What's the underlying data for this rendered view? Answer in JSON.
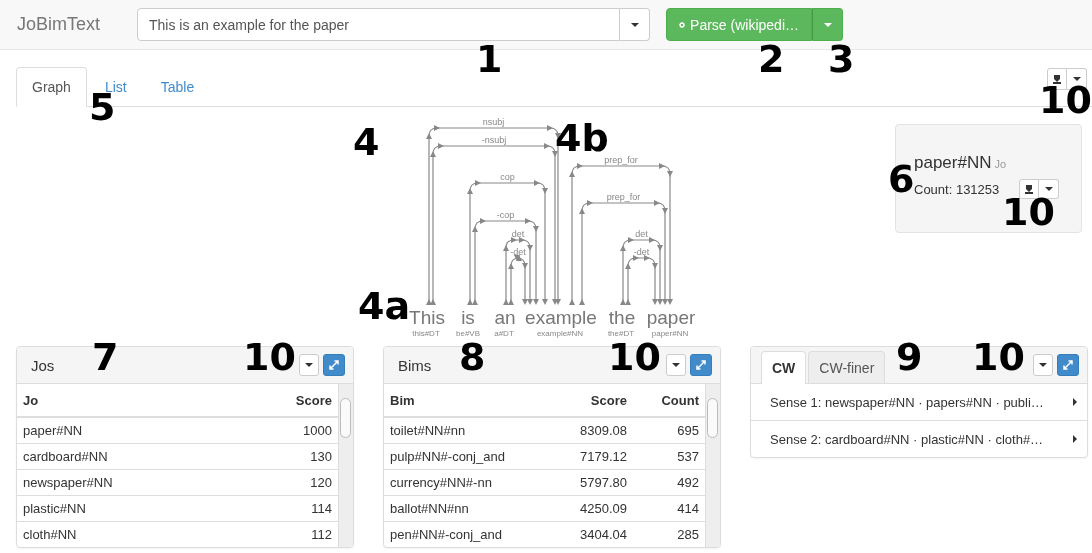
{
  "app": {
    "brand": "JoBimText"
  },
  "query": {
    "value": "This is an example for the paper"
  },
  "parse_button": {
    "label": "Parse (wikipedi…"
  },
  "tabs": [
    {
      "label": "Graph",
      "selected": true
    },
    {
      "label": "List",
      "selected": false
    },
    {
      "label": "Table",
      "selected": false
    }
  ],
  "graph": {
    "words": [
      {
        "word": "This",
        "tag": "this#DT"
      },
      {
        "word": "is",
        "tag": "be#VB"
      },
      {
        "word": "an",
        "tag": "a#DT"
      },
      {
        "word": "example",
        "tag": "example#NN"
      },
      {
        "word": "the",
        "tag": "the#DT"
      },
      {
        "word": "paper",
        "tag": "paper#NN"
      }
    ],
    "arcs": [
      {
        "label": "nsubj",
        "children": [
          {
            "label": "-nsubj",
            "children": [
              {
                "label": "cop",
                "children": [
                  {
                    "label": "-cop",
                    "children": [
                      {
                        "label": "det",
                        "children": [
                          {
                            "label": "-det"
                          }
                        ]
                      }
                    ]
                  }
                ]
              }
            ]
          }
        ]
      },
      {
        "label": "prep_for",
        "children": [
          {
            "label": "prep_for",
            "children": [
              {
                "label": "det",
                "children": [
                  {
                    "label": "-det"
                  }
                ]
              }
            ]
          }
        ]
      }
    ]
  },
  "term_card": {
    "term": "paper#NN",
    "type": "Jo",
    "count": "Count: 131253"
  },
  "jos_panel": {
    "title": "Jos",
    "columns": [
      "Jo",
      "Score"
    ],
    "rows": [
      [
        "paper#NN",
        "1000"
      ],
      [
        "cardboard#NN",
        "130"
      ],
      [
        "newspaper#NN",
        "120"
      ],
      [
        "plastic#NN",
        "114"
      ],
      [
        "cloth#NN",
        "112"
      ]
    ]
  },
  "bims_panel": {
    "title": "Bims",
    "columns": [
      "Bim",
      "Score",
      "Count"
    ],
    "rows": [
      [
        "toilet#NN#nn",
        "8309.08",
        "695"
      ],
      [
        "pulp#NN#-conj_and",
        "7179.12",
        "537"
      ],
      [
        "currency#NN#-nn",
        "5797.80",
        "492"
      ],
      [
        "ballot#NN#nn",
        "4250.09",
        "414"
      ],
      [
        "pen#NN#-conj_and",
        "3404.04",
        "285"
      ]
    ]
  },
  "senses_panel": {
    "tabs": [
      {
        "label": "CW",
        "selected": true
      },
      {
        "label": "CW-finer",
        "selected": false
      }
    ],
    "items": [
      "Sense 1: newspaper#NN · papers#NN · publi…",
      "Sense 2: cardboard#NN · plastic#NN · cloth#…"
    ]
  },
  "callouts": [
    {
      "text": "1"
    },
    {
      "text": "2"
    },
    {
      "text": "3"
    },
    {
      "text": "5"
    },
    {
      "text": "4"
    },
    {
      "text": "4b"
    },
    {
      "text": "4a"
    },
    {
      "text": "6"
    },
    {
      "text": "10"
    },
    {
      "text": "10"
    },
    {
      "text": "7"
    },
    {
      "text": "10"
    },
    {
      "text": "8"
    },
    {
      "text": "10"
    },
    {
      "text": "9"
    },
    {
      "text": "10"
    }
  ]
}
